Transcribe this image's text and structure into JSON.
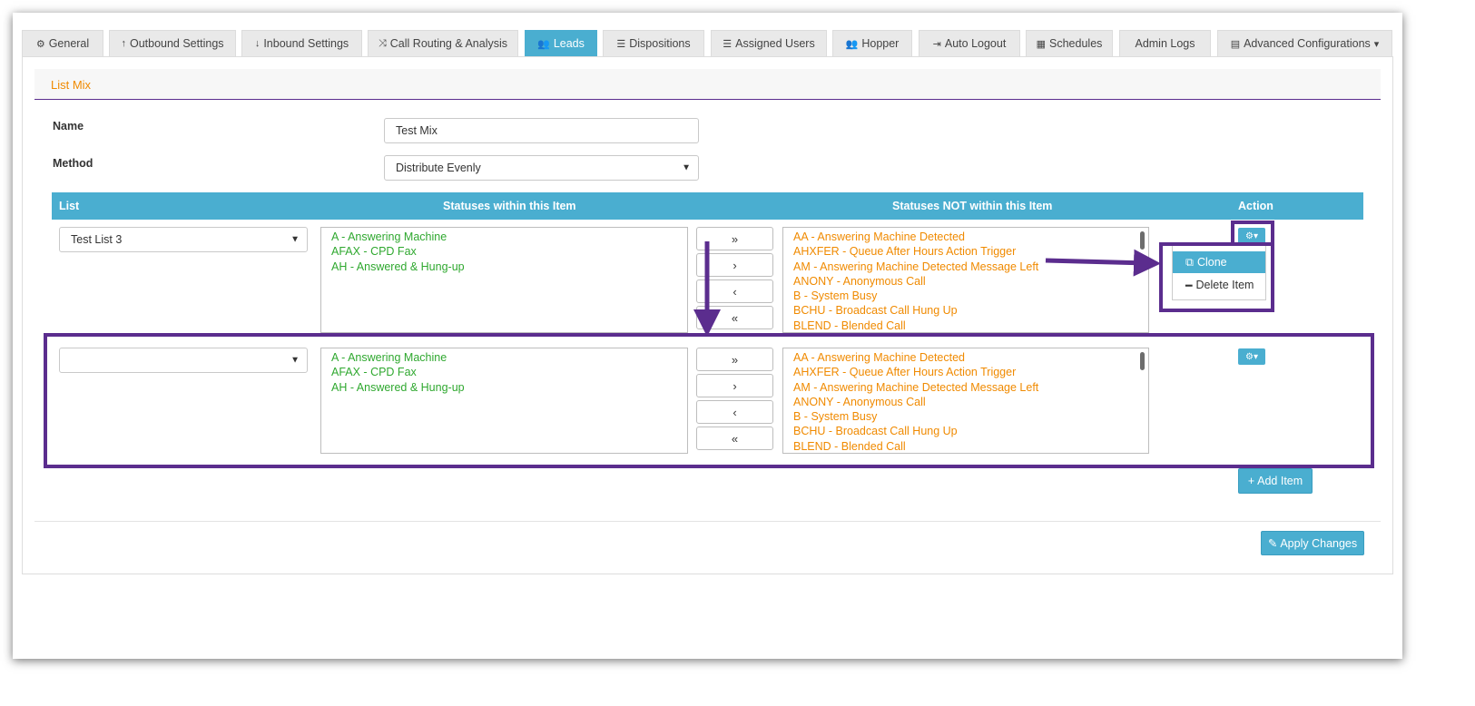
{
  "tabs": [
    {
      "icon": "⚙",
      "label": "General"
    },
    {
      "icon": "↑",
      "label": "Outbound Settings"
    },
    {
      "icon": "↓",
      "label": "Inbound Settings"
    },
    {
      "icon": "⤨",
      "label": "Call Routing & Analysis"
    },
    {
      "icon": "👥",
      "label": "Leads"
    },
    {
      "icon": "☰",
      "label": "Dispositions"
    },
    {
      "icon": "☰",
      "label": "Assigned Users"
    },
    {
      "icon": "👥",
      "label": "Hopper"
    },
    {
      "icon": "⇥",
      "label": "Auto Logout"
    },
    {
      "icon": "▦",
      "label": "Schedules"
    },
    {
      "icon": "",
      "label": "Admin Logs"
    },
    {
      "icon": "▤",
      "label": "Advanced Configurations",
      "caret": "▾"
    }
  ],
  "active_tab": "Leads",
  "panel": {
    "title": "List Mix"
  },
  "form": {
    "name_label": "Name",
    "name_value": "Test Mix",
    "method_label": "Method",
    "method_value": "Distribute Evenly"
  },
  "table": {
    "headers": {
      "list": "List",
      "statuses_in": "Statuses within this Item",
      "statuses_not": "Statuses NOT within this Item",
      "action": "Action"
    }
  },
  "rows": [
    {
      "list_value": "Test List 3",
      "statuses_in": [
        "A - Answering Machine",
        "AFAX - CPD Fax",
        "AH - Answered & Hung-up"
      ],
      "statuses_not": [
        "AA - Answering Machine Detected",
        "AHXFER - Queue After Hours Action Trigger",
        "AM - Answering Machine Detected Message Left",
        "ANONY - Anonymous Call",
        "B - System Busy",
        "BCHU - Broadcast Call Hung Up",
        "BLEND - Blended Call"
      ]
    },
    {
      "list_value": "",
      "statuses_in": [
        "A - Answering Machine",
        "AFAX - CPD Fax",
        "AH - Answered & Hung-up"
      ],
      "statuses_not": [
        "AA - Answering Machine Detected",
        "AHXFER - Queue After Hours Action Trigger",
        "AM - Answering Machine Detected Message Left",
        "ANONY - Anonymous Call",
        "B - System Busy",
        "BCHU - Broadcast Call Hung Up",
        "BLEND - Blended Call"
      ]
    }
  ],
  "move_buttons": [
    "»",
    "›",
    "‹",
    "«"
  ],
  "action_menu": {
    "gear": "⚙▾",
    "clone": "Clone",
    "clone_icon": "⧉",
    "delete": "Delete Item",
    "delete_icon": "━"
  },
  "buttons": {
    "add_item": "Add Item",
    "add_icon": "+",
    "apply": "Apply Changes",
    "apply_icon": "✎"
  },
  "colors": {
    "accent": "#4aaed0",
    "annotation": "#5b2d8e",
    "status_in": "#2fa82f",
    "status_not": "#f08a00"
  }
}
